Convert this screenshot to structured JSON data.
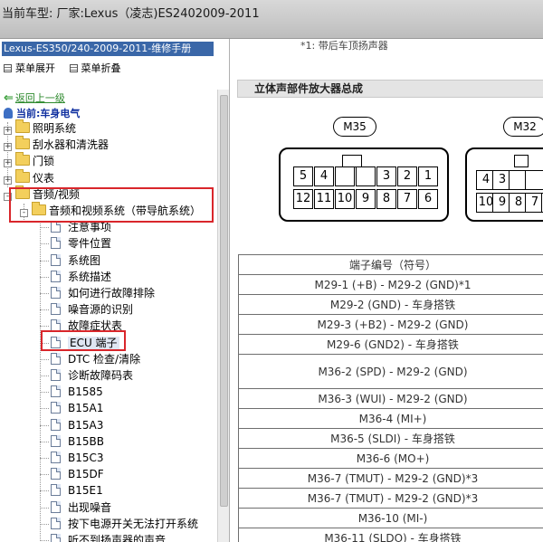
{
  "window": {
    "title": "当前车型:  厂家:Lexus（凌志)ES2402009-2011"
  },
  "left": {
    "manual_title": "Lexus-ES350/240-2009-2011-维修手册",
    "expand_all": "菜单展开",
    "collapse_all": "菜单折叠",
    "back_link": "返回上一级",
    "current": "当前:车身电气",
    "tree": [
      {
        "label": "照明系统",
        "kind": "folder",
        "expander": "+",
        "level": 0
      },
      {
        "label": "刮水器和清洗器",
        "kind": "folder",
        "expander": "+",
        "level": 0
      },
      {
        "label": "门锁",
        "kind": "folder",
        "expander": "+",
        "level": 0
      },
      {
        "label": "仪表",
        "kind": "folder",
        "expander": "+",
        "level": 0
      },
      {
        "label": "音频/视频",
        "kind": "folder",
        "expander": "-",
        "level": 0
      },
      {
        "label": "音频和视频系统（带导航系统）",
        "kind": "folder",
        "expander": "-",
        "level": 1
      },
      {
        "label": "注意事项",
        "kind": "doc",
        "level": 2
      },
      {
        "label": "零件位置",
        "kind": "doc",
        "level": 2
      },
      {
        "label": "系统图",
        "kind": "doc",
        "level": 2
      },
      {
        "label": "系统描述",
        "kind": "doc",
        "level": 2
      },
      {
        "label": "如何进行故障排除",
        "kind": "doc",
        "level": 2
      },
      {
        "label": "噪音源的识别",
        "kind": "doc",
        "level": 2
      },
      {
        "label": "故障症状表",
        "kind": "doc",
        "level": 2
      },
      {
        "label": "ECU 端子",
        "kind": "doc",
        "level": 2,
        "selected": true
      },
      {
        "label": "DTC 检查/清除",
        "kind": "doc",
        "level": 2
      },
      {
        "label": "诊断故障码表",
        "kind": "doc",
        "level": 2
      },
      {
        "label": "B1585",
        "kind": "doc",
        "level": 2
      },
      {
        "label": "B15A1",
        "kind": "doc",
        "level": 2
      },
      {
        "label": "B15A3",
        "kind": "doc",
        "level": 2
      },
      {
        "label": "B15BB",
        "kind": "doc",
        "level": 2
      },
      {
        "label": "B15C3",
        "kind": "doc",
        "level": 2
      },
      {
        "label": "B15DF",
        "kind": "doc",
        "level": 2
      },
      {
        "label": "B15E1",
        "kind": "doc",
        "level": 2
      },
      {
        "label": "出现噪音",
        "kind": "doc",
        "level": 2
      },
      {
        "label": "按下电源开关无法打开系统",
        "kind": "doc",
        "level": 2
      },
      {
        "label": "听不到扬声器的声音",
        "kind": "doc",
        "level": 2
      }
    ]
  },
  "right": {
    "note_top": "*1: 带后车顶扬声器",
    "section_title": "立体声部件放大器总成",
    "connectors": [
      {
        "label": "M35",
        "top_row": [
          "5",
          "4",
          "",
          "",
          "3",
          "2",
          "1"
        ],
        "bottom_row": [
          "12",
          "11",
          "10",
          "9",
          "8",
          "7",
          "6"
        ]
      },
      {
        "label": "M32",
        "top_row": [
          "4",
          "3",
          "",
          ""
        ],
        "bottom_row": [
          "10",
          "9",
          "8",
          "7",
          "6"
        ]
      }
    ],
    "table": {
      "header": "端子编号（符号）",
      "rows": [
        "M29-1 (+B) - M29-2 (GND)*1",
        "M29-2 (GND) - 车身搭铁",
        "M29-3 (+B2) - M29-2 (GND)",
        "M29-6 (GND2) - 车身搭铁",
        "M36-2 (SPD) - M29-2 (GND)",
        "M36-3 (WUI) - M29-2 (GND)",
        "M36-4 (MI+)",
        "M36-5 (SLDI) - 车身搭铁",
        "M36-6 (MO+)",
        "M36-7 (TMUT) - M29-2 (GND)*3",
        "M36-7 (TMUT) - M29-2 (GND)*3",
        "M36-10 (MI-)",
        "M36-11 (SLDO) - 车身搭铁"
      ]
    }
  },
  "colors": {
    "manual_header_bg": "#3a67a8",
    "highlight_box": "#d9262b",
    "back_link": "#2e8a2e",
    "current_text": "#1030a0"
  }
}
